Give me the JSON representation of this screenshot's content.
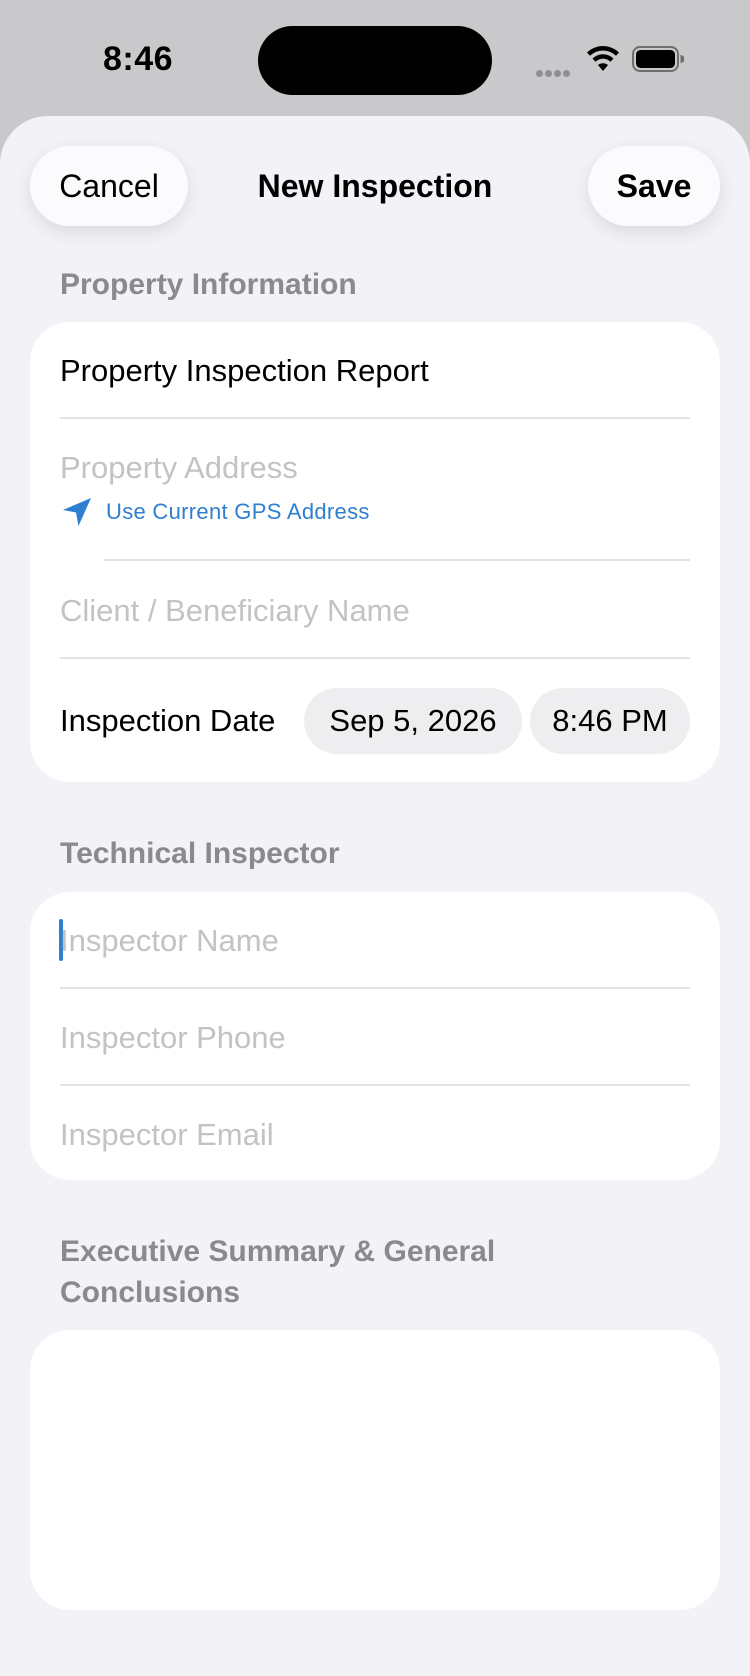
{
  "status_bar": {
    "time": "8:46",
    "icons": [
      "cellular-dots-icon",
      "wifi-icon",
      "battery-icon"
    ]
  },
  "nav": {
    "cancel_label": "Cancel",
    "title": "New Inspection",
    "save_label": "Save"
  },
  "property": {
    "header": "Property Information",
    "report_title": "Property Inspection Report",
    "address_placeholder": "Property Address",
    "gps_label": "Use Current GPS Address",
    "client_placeholder": "Client / Beneficiary Name",
    "date_label": "Inspection Date",
    "date_value": "Sep 5, 2026",
    "time_value": "8:46 PM"
  },
  "inspector": {
    "header": "Technical Inspector",
    "name_placeholder": "Inspector Name",
    "phone_placeholder": "Inspector Phone",
    "email_placeholder": "Inspector Email"
  },
  "summary": {
    "header": "Executive Summary & General Conclusions",
    "text": ""
  },
  "colors": {
    "accent": "#2f7fd1",
    "background": "#f2f2f7",
    "placeholder": "#c3c3c6",
    "section_header": "#8a8a8e"
  }
}
